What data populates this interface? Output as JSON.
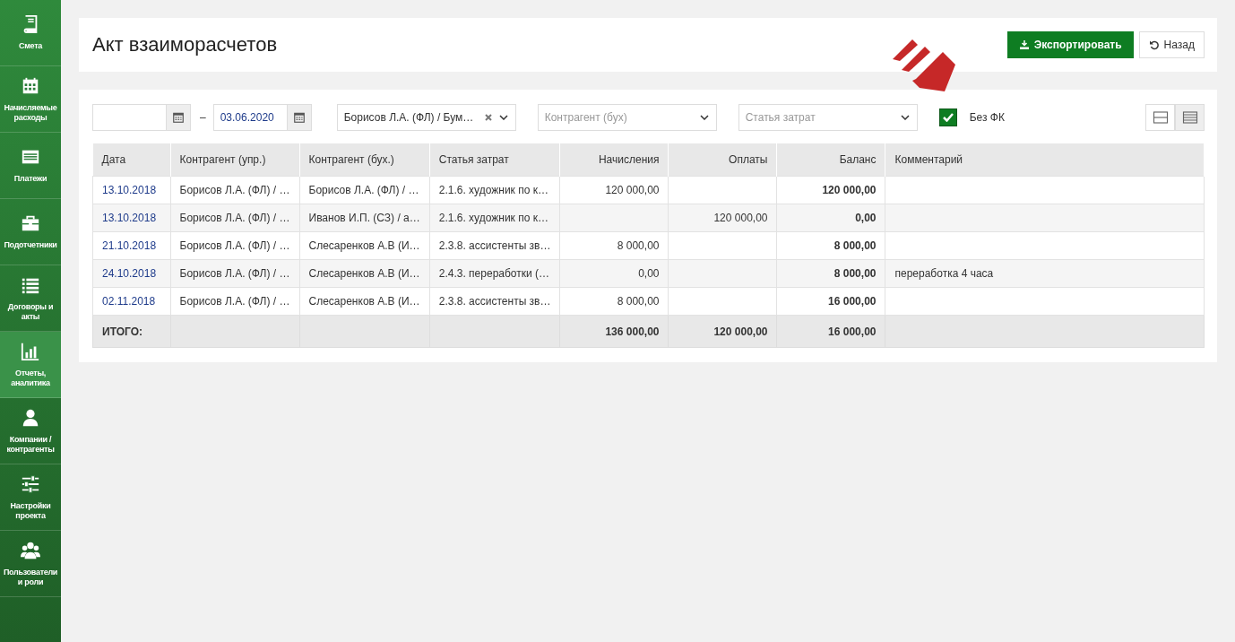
{
  "sidebar": {
    "items": [
      {
        "label": "Смета",
        "selected": false
      },
      {
        "label": "Начисляемые расходы",
        "selected": false
      },
      {
        "label": "Платежи",
        "selected": false
      },
      {
        "label": "Подотчетники",
        "selected": false
      },
      {
        "label": "Договоры и акты",
        "selected": false
      },
      {
        "label": "Отчеты, аналитика",
        "selected": true
      },
      {
        "label": "Компании / контрагенты",
        "selected": false
      },
      {
        "label": "Настройки проекта",
        "selected": false
      },
      {
        "label": "Пользователи и роли",
        "selected": false
      }
    ]
  },
  "page": {
    "title": "Акт взаиморасчетов",
    "buttons": [
      {
        "kind": "primary",
        "label": "Экспортировать"
      },
      {
        "kind": "default",
        "label": "Назад"
      }
    ]
  },
  "filters": {
    "date_to": {
      "value": "03.06.2020"
    },
    "date_separator": "–",
    "selects": [
      {
        "value": "Борисов Л.А. (ФЛ) / Бум…",
        "clearable": true
      },
      {
        "placeholder": "Контрагент (бух)",
        "clearable": false
      },
      {
        "placeholder": "Статья затрат",
        "clearable": false
      }
    ],
    "checkbox": {
      "label": "Без ФК",
      "checked": true
    },
    "view_modes": [
      {
        "selected": false
      },
      {
        "selected": true
      }
    ]
  },
  "table": {
    "columns": [
      "Дата",
      "Контрагент (упр.)",
      "Контрагент (бух.)",
      "Статья затрат",
      "Начисления",
      "Оплаты",
      "Баланс",
      "Комментарий"
    ],
    "rows": [
      {
        "date": "13.10.2018",
        "counterparty_mgmt": "Борисов Л.А. (ФЛ) / …",
        "counterparty_acc": "Борисов Л.А. (ФЛ) / …",
        "cost_item": "2.1.6. художник по к…",
        "accruals": "120 000,00",
        "balance": "120 000,00"
      },
      {
        "date": "13.10.2018",
        "counterparty_mgmt": "Борисов Л.А. (ФЛ) / …",
        "counterparty_acc": "Иванов И.П. (СЗ) / а…",
        "cost_item": "2.1.6. художник по к…",
        "payments": "120 000,00",
        "balance": "0,00"
      },
      {
        "date": "21.10.2018",
        "counterparty_mgmt": "Борисов Л.А. (ФЛ) / …",
        "counterparty_acc": "Слесаренков А.В (И…",
        "cost_item": "2.3.8. ассистенты зв…",
        "accruals": "8 000,00",
        "balance": "8 000,00"
      },
      {
        "date": "24.10.2018",
        "counterparty_mgmt": "Борисов Л.А. (ФЛ) / …",
        "counterparty_acc": "Слесаренков А.В (И…",
        "cost_item": "2.4.3. переработки (…",
        "accruals": "0,00",
        "balance": "8 000,00",
        "comment": "переработка 4 часа"
      },
      {
        "date": "02.11.2018",
        "counterparty_mgmt": "Борисов Л.А. (ФЛ) / …",
        "counterparty_acc": "Слесаренков А.В (И…",
        "cost_item": "2.3.8. ассистенты зв…",
        "accruals": "8 000,00",
        "balance": "16 000,00"
      }
    ],
    "total": {
      "label": "ИТОГО:",
      "accruals": "136 000,00",
      "payments": "120 000,00",
      "balance": "16 000,00"
    }
  }
}
